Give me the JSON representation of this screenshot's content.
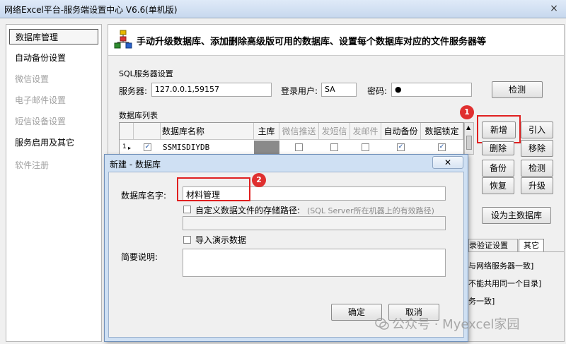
{
  "window": {
    "title": "网络Excel平台-服务端设置中心 V6.6(单机版)",
    "close_glyph": "×"
  },
  "sidebar": {
    "items": [
      {
        "label": "数据库管理",
        "state": "selected"
      },
      {
        "label": "自动备份设置",
        "state": "enabled"
      },
      {
        "label": "微信设置",
        "state": "disabled"
      },
      {
        "label": "电子邮件设置",
        "state": "disabled"
      },
      {
        "label": "短信设备设置",
        "state": "disabled"
      },
      {
        "label": "服务启用及其它",
        "state": "enabled"
      },
      {
        "label": "软件注册",
        "state": "disabled"
      }
    ]
  },
  "banner": {
    "icon": "database-network-icon",
    "text": "手动升级数据库、添加删除高级版可用的数据库、设置每个数据库对应的文件服务器等"
  },
  "sql_server": {
    "group_label": "SQL服务器设置",
    "server_label": "服务器:",
    "server_value": "127.0.0.1,59157",
    "user_label": "登录用户:",
    "user_value": "SA",
    "password_label": "密码:",
    "password_value": "●",
    "check_button": "检测"
  },
  "db_list": {
    "group_label": "数据库列表",
    "columns": [
      "数据库名称",
      "主库",
      "微信推送",
      "发短信",
      "发邮件",
      "自动备份",
      "数据锁定"
    ],
    "rows": [
      {
        "index": "1",
        "selected": true,
        "name": "SSMISDIYDB",
        "main": false,
        "wechat": false,
        "sms": false,
        "email": false,
        "auto_backup": true,
        "locked": true
      }
    ]
  },
  "buttons": {
    "add": "新增",
    "import": "引入",
    "delete": "删除",
    "remove": "移除",
    "backup": "备份",
    "check": "检测",
    "restore": "恢复",
    "upgrade": "升级",
    "set_main": "设为主数据库"
  },
  "tabs": [
    "录验证设置",
    "其它"
  ],
  "partial_notes": [
    "与网络服务器一致]",
    "不能共用同一个目录]",
    "务一致]"
  ],
  "annotations": [
    "1",
    "2"
  ],
  "dialog": {
    "title": "新建 - 数据库",
    "close_glyph": "✕",
    "name_label": "数据库名字:",
    "name_value": "材料管理",
    "custom_path_label": "自定义数据文件的存储路径:",
    "custom_path_hint": "(SQL Server所在机器上的有效路径)",
    "path_value": "",
    "import_demo_label": "导入演示数据",
    "desc_label": "简要说明:",
    "desc_value": "",
    "ok": "确定",
    "cancel": "取消"
  },
  "watermark": "公众号 · Myexcel家园",
  "colors": {
    "highlight": "#e02020",
    "dialog_frame": "#cfe0f3",
    "desktop": "#6f9bd6"
  }
}
